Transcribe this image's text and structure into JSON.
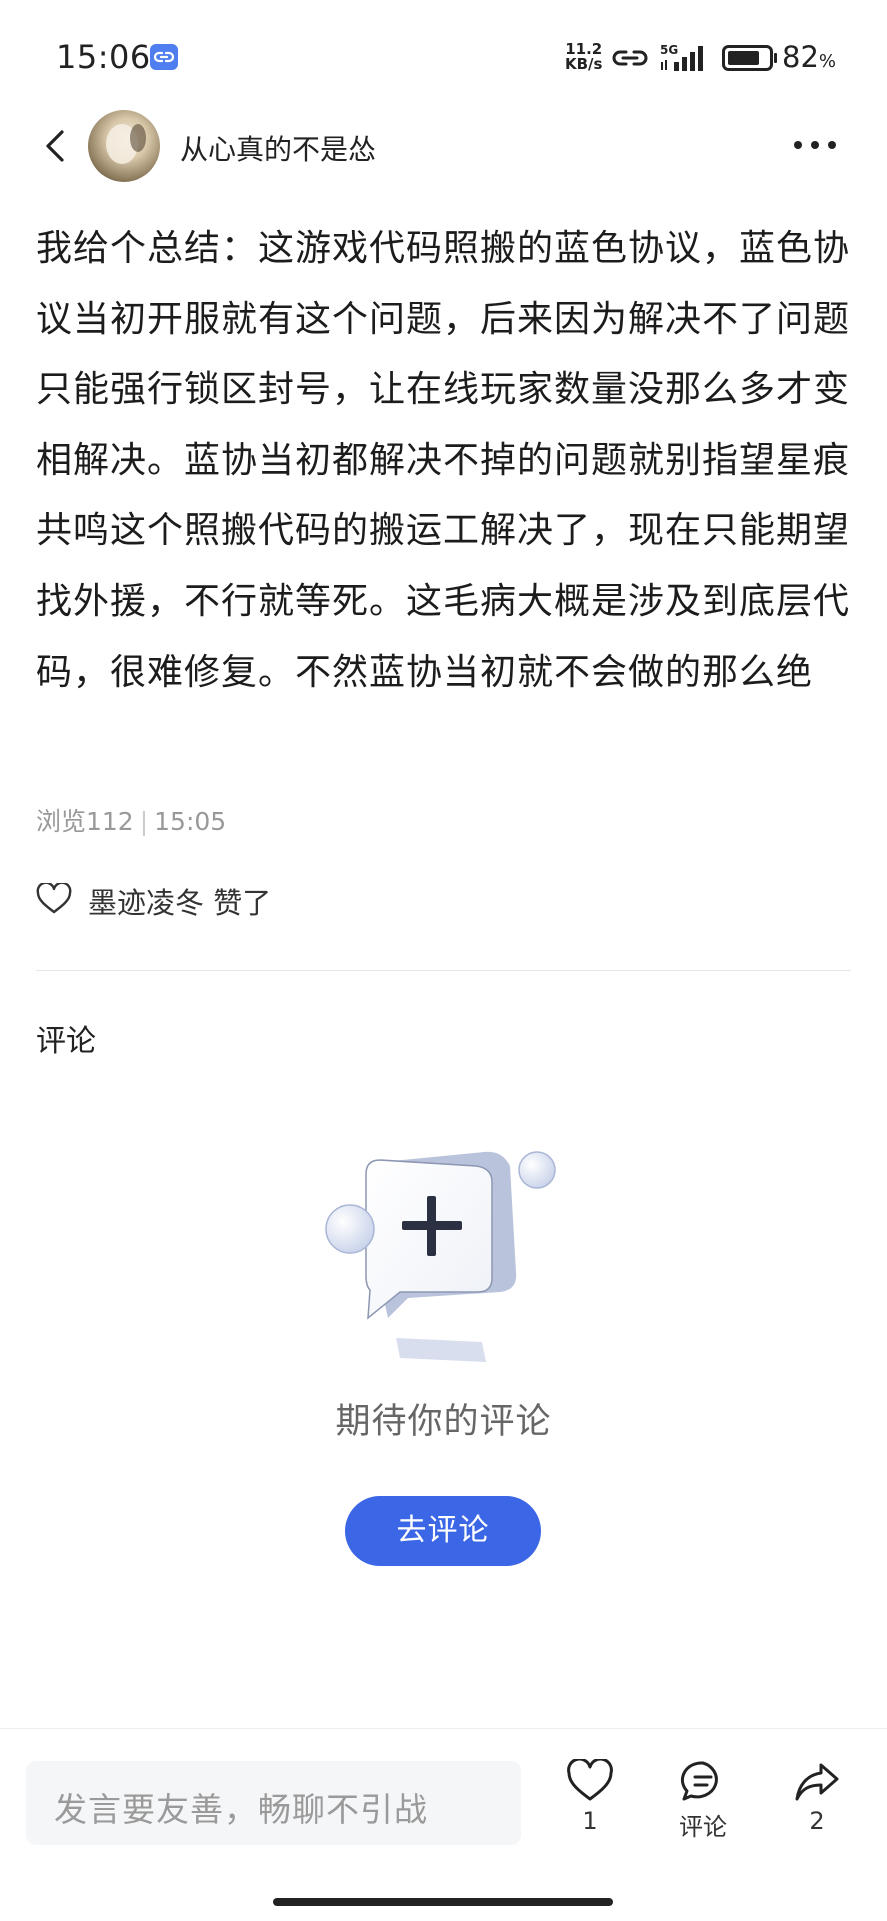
{
  "status_bar": {
    "time": "15:06",
    "net_speed_value": "11.2",
    "net_speed_unit": "KB/s",
    "network": "5G",
    "battery_percent": "82",
    "battery_unit": "%",
    "battery_level": 0.82
  },
  "header": {
    "username": "从心真的不是怂"
  },
  "post": {
    "body": "我给个总结：这游戏代码照搬的蓝色协议，蓝色协议当初开服就有这个问题，后来因为解决不了问题只能强行锁区封号，让在线玩家数量没那么多才变相解决。蓝协当初都解决不掉的问题就别指望星痕共鸣这个照搬代码的搬运工解决了，现在只能期望找外援，不行就等死。这毛病大概是涉及到底层代码，很难修复。不然蓝协当初就不会做的那么绝",
    "views_label": "浏览112",
    "separator": "|",
    "time": "15:05",
    "liked_by": "墨迹凌冬 赞了"
  },
  "comments": {
    "title": "评论",
    "empty_text": "期待你的评论",
    "go_comment_button": "去评论"
  },
  "bottom_bar": {
    "input_placeholder": "发言要友善，畅聊不引战",
    "like_count": "1",
    "comment_label": "评论",
    "share_count": "2"
  },
  "colors": {
    "accent": "#3b66e6",
    "link_badge": "#4f7ef0"
  },
  "icons": [
    "link-icon",
    "hotspot-icon",
    "signal-icon",
    "battery-icon",
    "back-arrow-icon",
    "more-icon",
    "heart-icon",
    "comment-bubble-icon",
    "share-icon",
    "empty-comment-illustration"
  ]
}
